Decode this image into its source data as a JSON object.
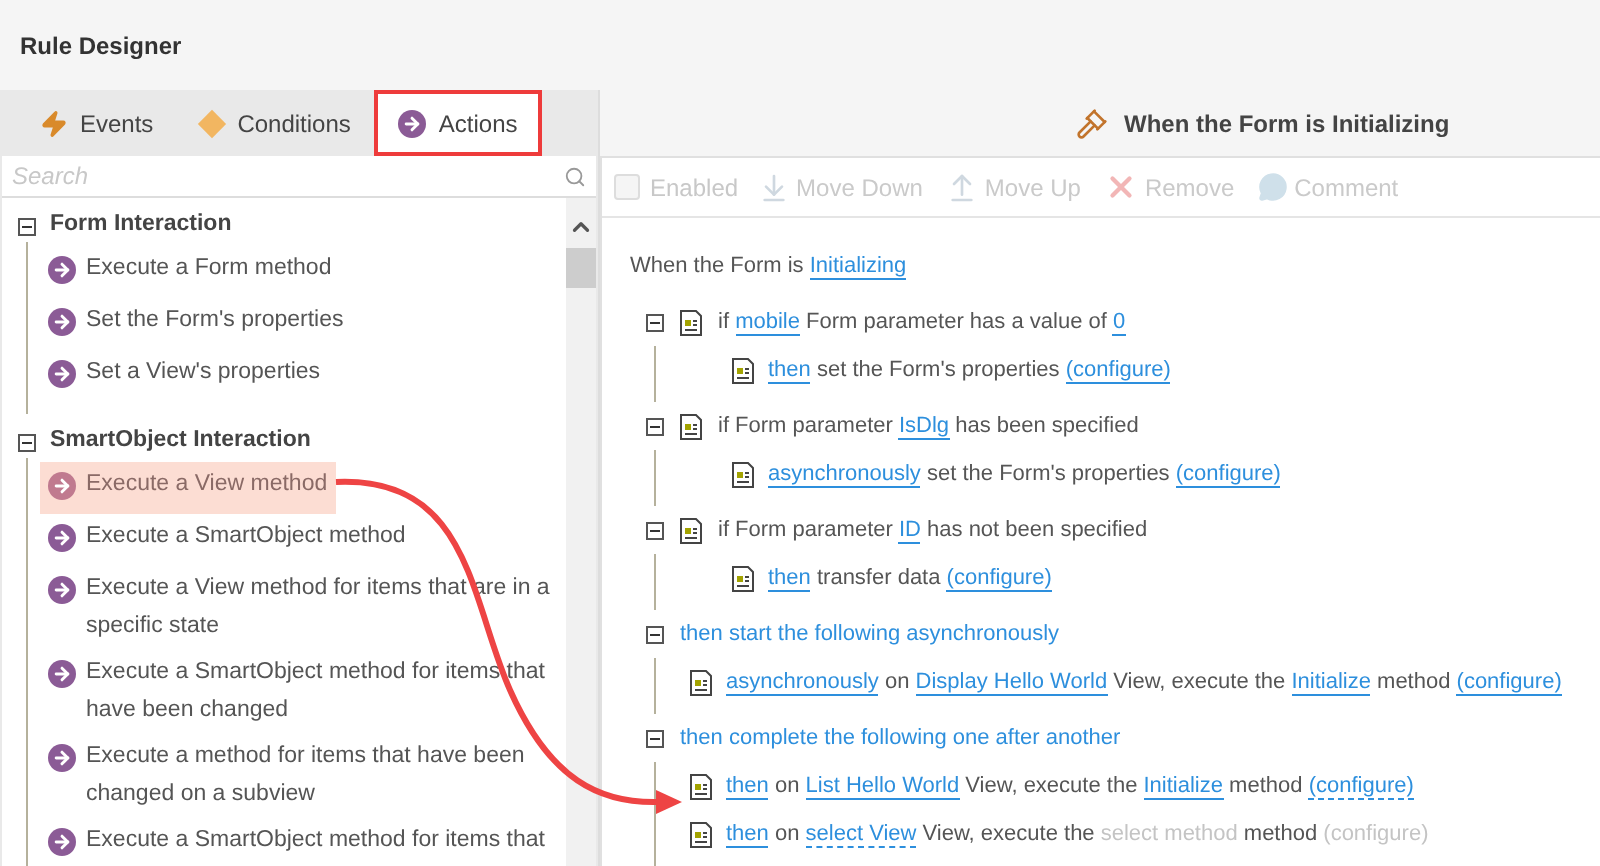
{
  "window": {
    "title": "Rule Designer"
  },
  "tabs": [
    {
      "kind": "events",
      "label": "Events",
      "selected": false
    },
    {
      "kind": "conditions",
      "label": "Conditions",
      "selected": false
    },
    {
      "kind": "actions",
      "label": "Actions",
      "selected": true
    }
  ],
  "search": {
    "placeholder": "Search"
  },
  "action_groups": [
    {
      "title": "Form Interaction",
      "expanded": true,
      "items": [
        {
          "label": "Execute a Form method",
          "selected": false
        },
        {
          "label": "Set the Form's properties",
          "selected": false
        },
        {
          "label": "Set a View's properties",
          "selected": false
        }
      ]
    },
    {
      "title": "SmartObject Interaction",
      "expanded": true,
      "items": [
        {
          "label": "Execute a View method",
          "selected": true
        },
        {
          "label": "Execute a SmartObject method",
          "selected": false
        },
        {
          "label": "Execute a View method for items that are in a specific state",
          "selected": false
        },
        {
          "label": "Execute a SmartObject method for items that have been changed",
          "selected": false
        },
        {
          "label": "Execute a method for items that have been changed on a subview",
          "selected": false
        },
        {
          "label": "Execute a SmartObject method for items that",
          "selected": false
        }
      ]
    }
  ],
  "rule_title": "When the Form is Initializing",
  "toolbar": {
    "enabled": {
      "label": "Enabled",
      "checked": false
    },
    "buttons": [
      {
        "kind": "move-down",
        "label": "Move Down",
        "disabled": true
      },
      {
        "kind": "move-up",
        "label": "Move Up",
        "disabled": true
      },
      {
        "kind": "remove",
        "label": "Remove",
        "disabled": true
      },
      {
        "kind": "comment",
        "label": "Comment",
        "disabled": true
      }
    ]
  },
  "rule": {
    "event": [
      {
        "kind": "text",
        "text": "When the Form is "
      },
      {
        "kind": "link",
        "text": "Initializing"
      }
    ],
    "blocks": [
      {
        "kind": "condition",
        "expanded": true,
        "line": [
          {
            "kind": "text",
            "text": "if "
          },
          {
            "kind": "link",
            "text": "mobile"
          },
          {
            "kind": "text",
            "text": " Form parameter has a value of "
          },
          {
            "kind": "link",
            "text": "0"
          }
        ],
        "children": [
          {
            "line": [
              {
                "kind": "link",
                "text": "then"
              },
              {
                "kind": "text",
                "text": " set the Form's properties "
              },
              {
                "kind": "link",
                "text": "(configure)"
              }
            ]
          }
        ]
      },
      {
        "kind": "condition",
        "expanded": true,
        "line": [
          {
            "kind": "text",
            "text": "if Form parameter "
          },
          {
            "kind": "link",
            "text": "IsDlg"
          },
          {
            "kind": "text",
            "text": " has been specified"
          }
        ],
        "children": [
          {
            "line": [
              {
                "kind": "link",
                "text": "asynchronously"
              },
              {
                "kind": "text",
                "text": " set the Form's properties "
              },
              {
                "kind": "link",
                "text": "(configure)"
              }
            ]
          }
        ]
      },
      {
        "kind": "condition",
        "expanded": true,
        "line": [
          {
            "kind": "text",
            "text": "if Form parameter "
          },
          {
            "kind": "link",
            "text": "ID"
          },
          {
            "kind": "text",
            "text": " has not been specified"
          }
        ],
        "children": [
          {
            "line": [
              {
                "kind": "link",
                "text": "then"
              },
              {
                "kind": "text",
                "text": " transfer data "
              },
              {
                "kind": "link",
                "text": "(configure)"
              }
            ]
          }
        ]
      },
      {
        "kind": "group",
        "expanded": true,
        "line": [
          {
            "kind": "group",
            "text": "then start the following asynchronously"
          }
        ],
        "children": [
          {
            "line": [
              {
                "kind": "link",
                "text": "asynchronously"
              },
              {
                "kind": "text",
                "text": " on "
              },
              {
                "kind": "link",
                "text": "Display Hello World"
              },
              {
                "kind": "text",
                "text": " View, execute the "
              },
              {
                "kind": "link",
                "text": "Initialize"
              },
              {
                "kind": "text",
                "text": " method "
              },
              {
                "kind": "link",
                "text": "(configure)"
              }
            ]
          }
        ]
      },
      {
        "kind": "group",
        "expanded": true,
        "line": [
          {
            "kind": "group",
            "text": "then complete the following one after another"
          }
        ],
        "children": [
          {
            "line": [
              {
                "kind": "link",
                "text": "then"
              },
              {
                "kind": "text",
                "text": " on "
              },
              {
                "kind": "link",
                "text": "List Hello World"
              },
              {
                "kind": "text",
                "text": " View, execute the "
              },
              {
                "kind": "link",
                "text": "Initialize"
              },
              {
                "kind": "text",
                "text": " method "
              },
              {
                "kind": "pending",
                "text": "(configure)"
              }
            ]
          },
          {
            "line": [
              {
                "kind": "link",
                "text": "then"
              },
              {
                "kind": "text",
                "text": " on "
              },
              {
                "kind": "pending",
                "text": "select View"
              },
              {
                "kind": "text",
                "text": " View, execute the "
              },
              {
                "kind": "placeholder",
                "text": "select method"
              },
              {
                "kind": "text",
                "text": " method "
              },
              {
                "kind": "placeholder",
                "text": "(configure)"
              }
            ]
          }
        ]
      }
    ]
  }
}
